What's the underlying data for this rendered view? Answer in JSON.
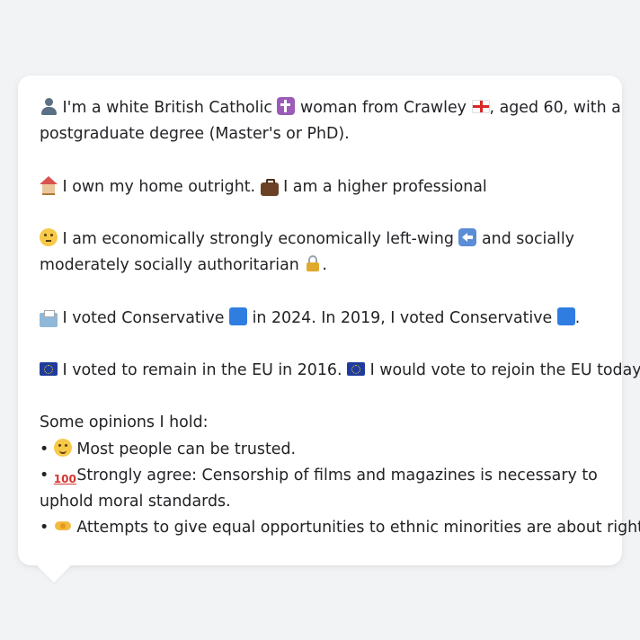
{
  "message": {
    "identity_line1": "I'm a white British Catholic",
    "identity_line1b": "woman from Crawley",
    "identity_line1c": ", aged 60, with a",
    "identity_line2": "postgraduate degree (Master's or PhD).",
    "home_text": "I own my home outright.",
    "job_text": "I am a higher professional",
    "econ_text": "I am economically strongly economically left-wing",
    "econ_text_b": "and socially",
    "social_text": "moderately socially authoritarian",
    "social_end": ".",
    "vote_text_a": "I voted Conservative",
    "vote_text_b": "in 2024. In 2019, I voted Conservative",
    "vote_end": ".",
    "eu_text_a": "I voted to remain in the EU in 2016.",
    "eu_text_b": "I would vote to rejoin the EU today.",
    "opinions_heading": "Some opinions I hold:",
    "bullet": "•",
    "opinion1": "Most people can be trusted.",
    "opinion2_line1": "Strongly agree: Censorship of films and magazines is necessary to",
    "opinion2_line2": "uphold moral standards.",
    "opinion3": "Attempts to give equal opportunities to ethnic minorities are about right."
  },
  "icons": [
    "person-icon",
    "latin-cross-icon",
    "england-flag-icon",
    "house-icon",
    "briefcase-icon",
    "thinking-face-icon",
    "left-arrow-icon",
    "lock-icon",
    "ballot-box-icon",
    "blue-square-icon",
    "eu-flag-icon",
    "smiling-face-icon",
    "hundred-points-icon",
    "handshake-icon"
  ],
  "colors": {
    "background": "#f2f3f5",
    "bubble": "#ffffff",
    "text": "#222326",
    "conservative_blue": "#2f7de1"
  }
}
